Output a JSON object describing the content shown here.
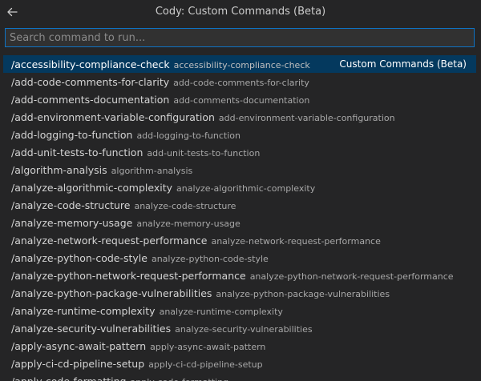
{
  "header": {
    "title": "Cody: Custom Commands (Beta)",
    "back_icon": "arrow-left-icon"
  },
  "search": {
    "placeholder": "Search command to run...",
    "value": ""
  },
  "colors": {
    "background": "#252526",
    "focus_border": "#0e73c4",
    "selected_row": "#04395e"
  },
  "commands": [
    {
      "label": "/accessibility-compliance-check",
      "description": "accessibility-compliance-check",
      "detail": "Custom Commands (Beta)",
      "selected": true
    },
    {
      "label": "/add-code-comments-for-clarity",
      "description": "add-code-comments-for-clarity"
    },
    {
      "label": "/add-comments-documentation",
      "description": "add-comments-documentation"
    },
    {
      "label": "/add-environment-variable-configuration",
      "description": "add-environment-variable-configuration"
    },
    {
      "label": "/add-logging-to-function",
      "description": "add-logging-to-function"
    },
    {
      "label": "/add-unit-tests-to-function",
      "description": "add-unit-tests-to-function"
    },
    {
      "label": "/algorithm-analysis",
      "description": "algorithm-analysis"
    },
    {
      "label": "/analyze-algorithmic-complexity",
      "description": "analyze-algorithmic-complexity"
    },
    {
      "label": "/analyze-code-structure",
      "description": "analyze-code-structure"
    },
    {
      "label": "/analyze-memory-usage",
      "description": "analyze-memory-usage"
    },
    {
      "label": "/analyze-network-request-performance",
      "description": "analyze-network-request-performance"
    },
    {
      "label": "/analyze-python-code-style",
      "description": "analyze-python-code-style"
    },
    {
      "label": "/analyze-python-network-request-performance",
      "description": "analyze-python-network-request-performance"
    },
    {
      "label": "/analyze-python-package-vulnerabilities",
      "description": "analyze-python-package-vulnerabilities"
    },
    {
      "label": "/analyze-runtime-complexity",
      "description": "analyze-runtime-complexity"
    },
    {
      "label": "/analyze-security-vulnerabilities",
      "description": "analyze-security-vulnerabilities"
    },
    {
      "label": "/apply-async-await-pattern",
      "description": "apply-async-await-pattern"
    },
    {
      "label": "/apply-ci-cd-pipeline-setup",
      "description": "apply-ci-cd-pipeline-setup"
    },
    {
      "label": "/apply-code-formatting",
      "description": "apply-code-formatting"
    }
  ]
}
